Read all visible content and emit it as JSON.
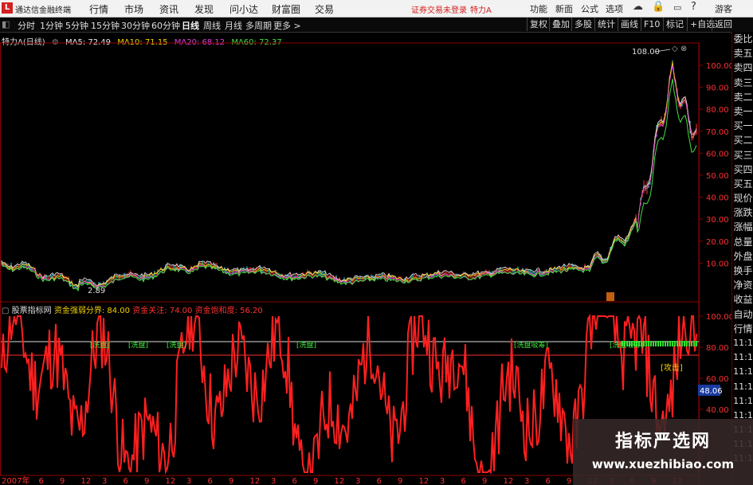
{
  "app": {
    "logo_letter": "L",
    "name": "通达信金融终端"
  },
  "menu": [
    "行情",
    "市场",
    "资讯",
    "发现",
    "问小达",
    "财富圈",
    "交易"
  ],
  "login_status": "证券交易未登录",
  "stock_name": "特力A",
  "right_menu": [
    "功能",
    "新面",
    "公式",
    "选项"
  ],
  "user": "游客",
  "periods": [
    "分时",
    "1分钟",
    "5分钟",
    "15分钟",
    "30分钟",
    "60分钟",
    "日线",
    "周线",
    "月线",
    "多周期",
    "更多 >"
  ],
  "active_period": "日线",
  "right_tools": [
    "复权",
    "叠加",
    "多股",
    "统计",
    "画线",
    "F10",
    "标记",
    "+自选",
    "返回"
  ],
  "ma_legend": {
    "stock_label": "特力A(日线)",
    "ma5": "MA5: 72.49",
    "ma10": "MA10: 71.15",
    "ma20": "MA20: 68.12",
    "ma60": "MA60: 72.37"
  },
  "price_axis": [
    "100.00",
    "90.00",
    "80.00",
    "70.00",
    "60.00",
    "50.00",
    "40.00",
    "30.00",
    "20.00",
    "10.00"
  ],
  "price_marks": {
    "high": "108.00",
    "low": "2.89"
  },
  "sidebar": [
    "委比",
    "卖五",
    "卖四",
    "卖三",
    "卖二",
    "卖一",
    "买一",
    "买二",
    "买三",
    "买四",
    "买五",
    "现价",
    "涨跌",
    "涨幅",
    "总量",
    "外盘",
    "换手",
    "净资",
    "收益",
    "自动",
    "行情",
    "11:1",
    "11:1",
    "11:1",
    "11:1",
    "11:1",
    "11:1",
    "11:1",
    "11:1",
    "11:1"
  ],
  "indicator": {
    "name": "股票指标网",
    "line1": "资金强弱分界: 84.00",
    "line2": "资金关注: 74.00",
    "line3": "资金饱和度: 56.20",
    "axis": [
      "100.00",
      "80.00",
      "60.00",
      "40.00"
    ],
    "current_value": "48.06",
    "signals": [
      "[洗盘]",
      "[洗盘]",
      "[洗盘]",
      "[洗盘]",
      "[洗盘吸筹]",
      "[洗盘吸筹]"
    ],
    "attack": "[攻击]"
  },
  "date_axis": [
    "2007年",
    "6",
    "9",
    "12",
    "3",
    "6",
    "9",
    "12",
    "3",
    "6",
    "9",
    "12",
    "3",
    "6",
    "9",
    "12",
    "3",
    "6",
    "9",
    "12",
    "3",
    "6",
    "9",
    "12",
    "3",
    "6",
    "9",
    "12",
    "3",
    "6",
    "9",
    "12"
  ],
  "watermark": {
    "title": "指标严选网",
    "url": "www.xuezhibiao.com"
  },
  "colors": {
    "ma5": "#e8e8e8",
    "ma10": "#f0d000",
    "ma20": "#e040e0",
    "ma60": "#40e040",
    "indicator": "#ff2020",
    "up": "#ff3030",
    "frame": "#8b0000"
  }
}
